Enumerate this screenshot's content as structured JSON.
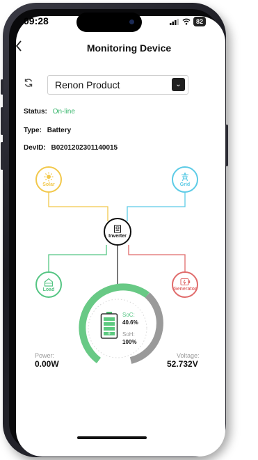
{
  "status_bar": {
    "time": "09:28",
    "battery": "82"
  },
  "header": {
    "title": "Monitoring Device",
    "back_icon": "chevron-left-icon"
  },
  "device_select": {
    "value": "Renon Product"
  },
  "info": {
    "status_label": "Status:",
    "status_value": "On-line",
    "type_label": "Type:",
    "type_value": "Battery",
    "devid_label": "DevID:",
    "devid_value": "B0201202301140015"
  },
  "energy_flow": {
    "solar_label": "Solar",
    "grid_label": "Grid",
    "inverter_label": "Inverter",
    "load_label": "Load",
    "generator_label": "Generator",
    "colors": {
      "solar": "#f2c84b",
      "grid": "#5ccbe6",
      "inverter": "#111111",
      "load": "#55c583",
      "generator": "#e06b6b"
    }
  },
  "battery": {
    "soc_label": "SoC:",
    "soc_value": "40.6%",
    "soh_label": "SoH:",
    "soh_value": "100%",
    "soc_fraction": 0.406
  },
  "readings": {
    "power_label": "Power:",
    "power_value": "0.00W",
    "voltage_label": "Voltage:",
    "voltage_value": "52.732V"
  }
}
